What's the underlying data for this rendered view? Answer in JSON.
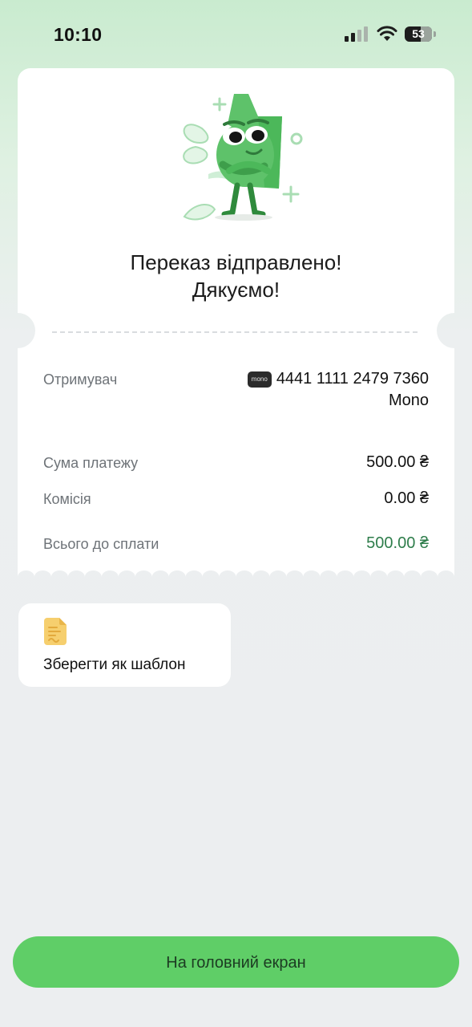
{
  "status_bar": {
    "time": "10:10",
    "battery": "53",
    "icons": [
      "cellular-signal-icon",
      "wifi-icon",
      "battery-icon"
    ]
  },
  "receipt": {
    "title_line1": "Переказ відправлено!",
    "title_line2": "Дякуємо!",
    "recipient_label": "Отримувач",
    "recipient_badge": "mono",
    "recipient_card": "4441 1111 2479 7360",
    "recipient_bank": "Mono",
    "amount_label": "Сума платежу",
    "amount_value": "500.00 ₴",
    "fee_label": "Комісія",
    "fee_value": "0.00 ₴",
    "total_label": "Всього до сплати",
    "total_value": "500.00 ₴"
  },
  "actions": {
    "save_template_label": "Зберегти як шаблон",
    "home_button_label": "На головний екран"
  },
  "colors": {
    "accent_green": "#5fce67",
    "total_green": "#2e7d4b",
    "mascot_green": "#4cb85a"
  }
}
